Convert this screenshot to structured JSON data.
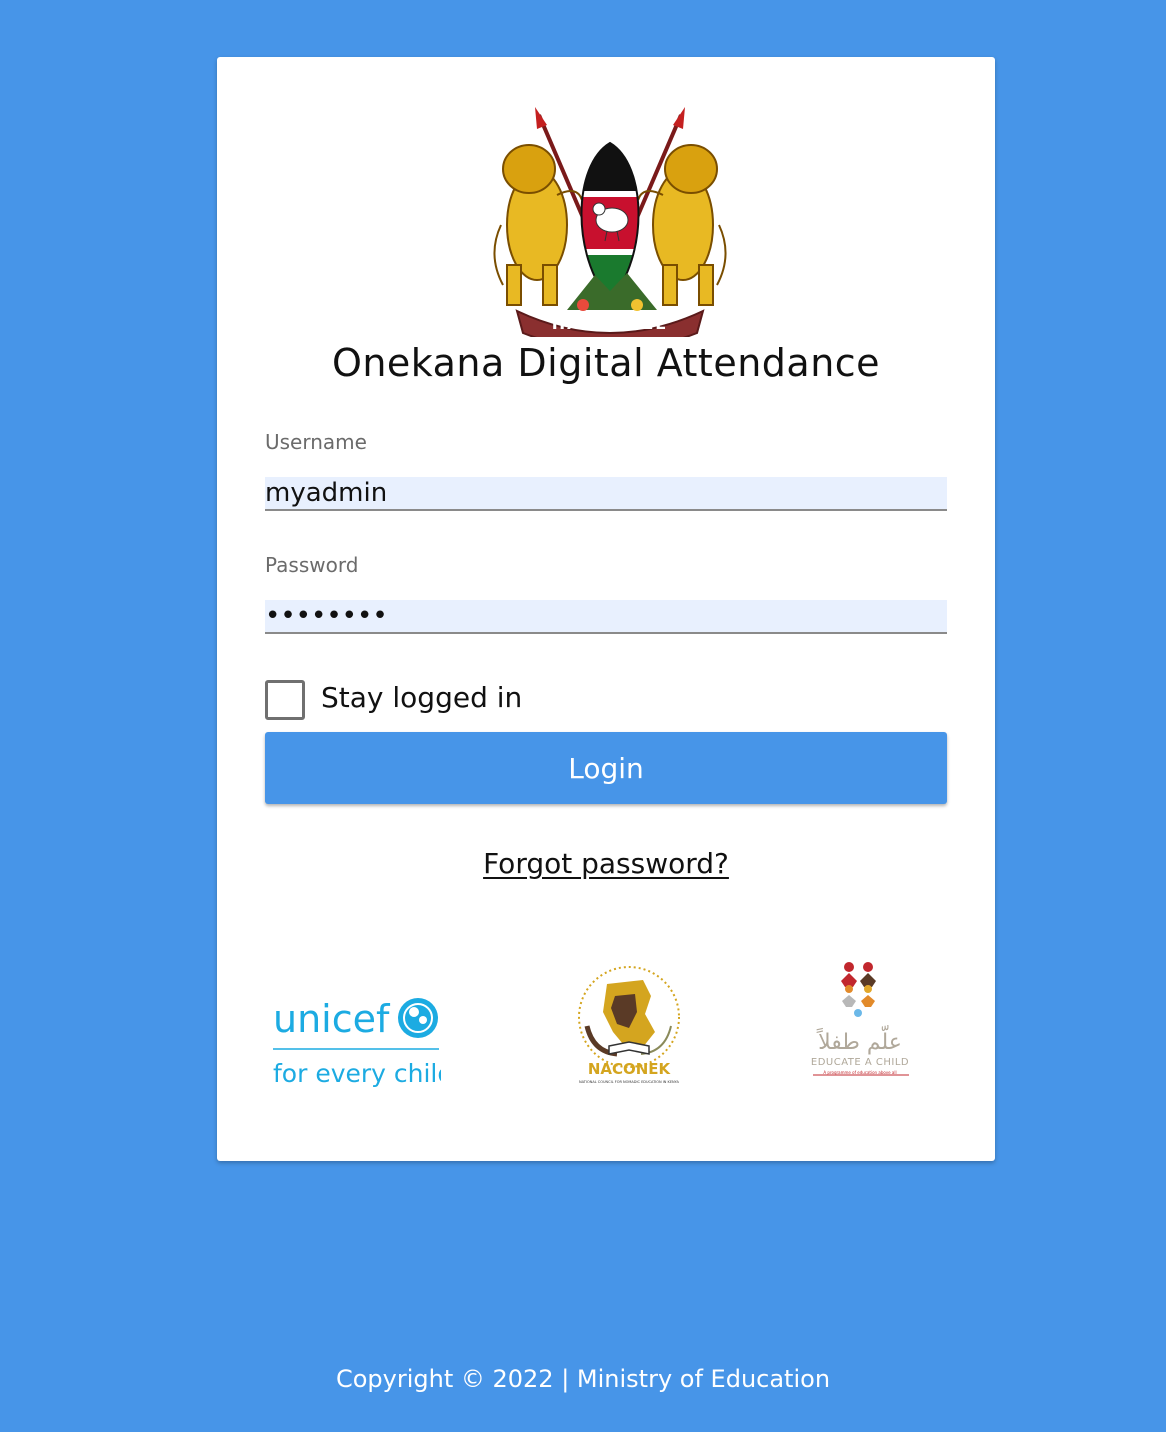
{
  "app": {
    "title": "Onekana Digital Attendance"
  },
  "form": {
    "username_label": "Username",
    "username_value": "myadmin",
    "password_label": "Password",
    "password_value": "myadmin1",
    "stay_logged_in_label": "Stay logged in",
    "stay_logged_in_checked": false,
    "login_label": "Login",
    "forgot_label": "Forgot password?"
  },
  "emblem": {
    "motto": "HARAMBEE"
  },
  "partners": {
    "unicef_name": "unicef",
    "unicef_tagline": "for every child",
    "naconek_name": "NACONEK",
    "naconek_full": "NATIONAL COUNCIL FOR NOMADIC EDUCATION IN KENYA",
    "naconek_ring": "SUSTAINABLE, EQUITABLE & QUALITY EDUCATION",
    "eac_arabic": "علّم طفلاً",
    "eac_name": "EDUCATE A CHILD",
    "eac_sub": "A programme of education above all"
  },
  "footer": {
    "copyright": "Copyright © 2022 | Ministry of Education"
  },
  "colors": {
    "background": "#4795e8",
    "button": "#4795e8",
    "input_bg": "#e8f0fe",
    "unicef_blue": "#1cabe2",
    "naconek_gold": "#d4a51f",
    "naconek_brown": "#5a3a26",
    "eac_red": "#c1272d"
  },
  "icons": [
    "kenya-coat-of-arms",
    "unicef-logo",
    "naconek-logo",
    "educate-a-child-logo"
  ]
}
